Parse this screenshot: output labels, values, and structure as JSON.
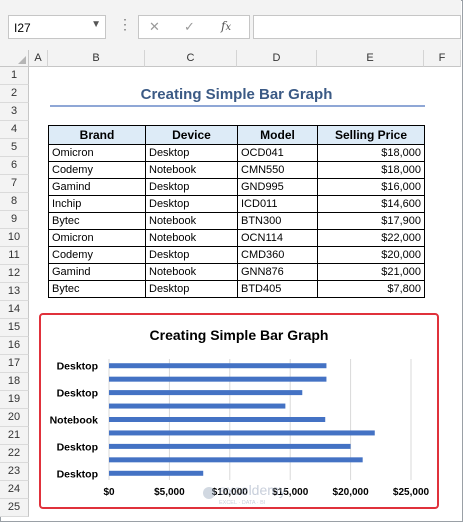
{
  "formula_bar": {
    "cell_ref": "I27",
    "dropdown_icon": "chevron-down-icon",
    "cancel_icon": "close-icon",
    "enter_icon": "check-icon",
    "function_icon": "fx-icon",
    "formula": ""
  },
  "columns": [
    "A",
    "B",
    "C",
    "D",
    "E",
    "F"
  ],
  "rows": [
    "1",
    "2",
    "3",
    "4",
    "5",
    "6",
    "7",
    "8",
    "9",
    "10",
    "11",
    "12",
    "13",
    "14",
    "15",
    "16",
    "17",
    "18",
    "19",
    "20",
    "21",
    "22",
    "23",
    "24",
    "25"
  ],
  "sheet": {
    "title": "Creating Simple Bar Graph",
    "table": {
      "headers": [
        "Brand",
        "Device",
        "Model",
        "Selling Price"
      ],
      "rows": [
        [
          "Omicron",
          "Desktop",
          "OCD041",
          "$18,000"
        ],
        [
          "Codemy",
          "Notebook",
          "CMN550",
          "$18,000"
        ],
        [
          "Gamind",
          "Desktop",
          "GND995",
          "$16,000"
        ],
        [
          "Inchip",
          "Desktop",
          "ICD011",
          "$14,600"
        ],
        [
          "Bytec",
          "Notebook",
          "BTN300",
          "$17,900"
        ],
        [
          "Omicron",
          "Notebook",
          "OCN114",
          "$22,000"
        ],
        [
          "Codemy",
          "Desktop",
          "CMD360",
          "$20,000"
        ],
        [
          "Gamind",
          "Notebook",
          "GNN876",
          "$21,000"
        ],
        [
          "Bytec",
          "Desktop",
          "BTD405",
          "$7,800"
        ]
      ]
    }
  },
  "chart_data": {
    "type": "bar",
    "orientation": "horizontal",
    "title": "Creating Simple Bar Graph",
    "categories": [
      "Desktop",
      "Notebook",
      "Desktop",
      "Desktop",
      "Notebook",
      "Notebook",
      "Desktop",
      "Notebook",
      "Desktop"
    ],
    "category_labels_shown": [
      "Desktop",
      "Desktop",
      "Notebook",
      "Desktop",
      "Desktop"
    ],
    "values": [
      18000,
      18000,
      16000,
      14600,
      17900,
      22000,
      20000,
      21000,
      7800
    ],
    "xlim": [
      0,
      25000
    ],
    "xticks": [
      "$0",
      "$5,000",
      "$10,000",
      "$15,000",
      "$20,000",
      "$25,000"
    ],
    "grid": true,
    "bar_color": "#4472c4",
    "grid_color": "#d9d9d9",
    "highlight_border": "#e0313b"
  },
  "watermark": {
    "name": "exceldemy",
    "tagline": "EXCEL · DATA · BI"
  }
}
